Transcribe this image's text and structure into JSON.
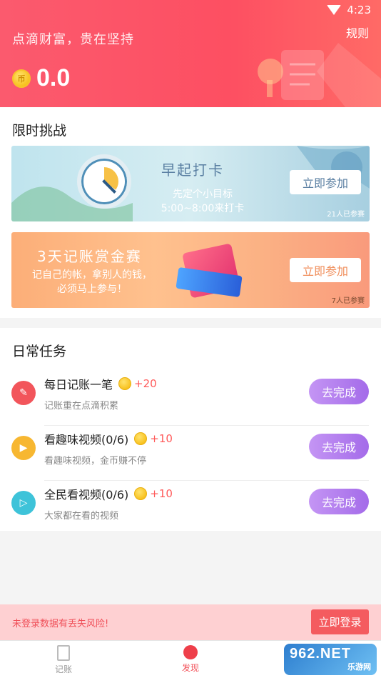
{
  "status_bar": {
    "time": "4:23"
  },
  "header": {
    "slogan": "点滴财富，贵在坚持",
    "rules_label": "规则",
    "balance": "0.0"
  },
  "challenges": {
    "title": "限时挑战",
    "items": [
      {
        "title": "早起打卡",
        "subtitle_line1": "先定个小目标",
        "subtitle_line2": "5:00~8:00来打卡",
        "button": "立即参加",
        "participants": "21人已参赛",
        "accent": "#5a7fa2"
      },
      {
        "title": "3天记账赏金赛",
        "subtitle_line1": "记自己的帐，拿别人的钱，",
        "subtitle_line2": "必须马上参与！",
        "button": "立即参加",
        "participants": "7人已参赛",
        "accent": "#f08e5b"
      }
    ]
  },
  "daily_tasks": {
    "title": "日常任务",
    "items": [
      {
        "name": "每日记账一笔",
        "reward": "+20",
        "desc": "记账重在点滴积累",
        "button": "去完成",
        "icon": "pencil-icon",
        "color": "#f2555b"
      },
      {
        "name": "看趣味视频(0/6)",
        "reward": "+10",
        "desc": "看趣味视频，金币赚不停",
        "button": "去完成",
        "icon": "video-icon",
        "color": "#f7b731"
      },
      {
        "name": "全民看视频(0/6)",
        "reward": "+10",
        "desc": "大家都在看的视频",
        "button": "去完成",
        "icon": "tv-icon",
        "color": "#3ec3d9"
      }
    ]
  },
  "login_warning": {
    "text": "未登录数据有丢失风险!",
    "button": "立即登录"
  },
  "bottom_nav": {
    "items": [
      {
        "label": "记账",
        "icon": "book-icon",
        "active": false
      },
      {
        "label": "发现",
        "icon": "discover-icon",
        "active": true
      }
    ]
  },
  "watermark": {
    "top": "962.NET",
    "bottom": "乐游网"
  },
  "colors": {
    "primary": "#fd4f62",
    "button_purple": "#a46be9",
    "warning_bg": "#fed0d2"
  }
}
